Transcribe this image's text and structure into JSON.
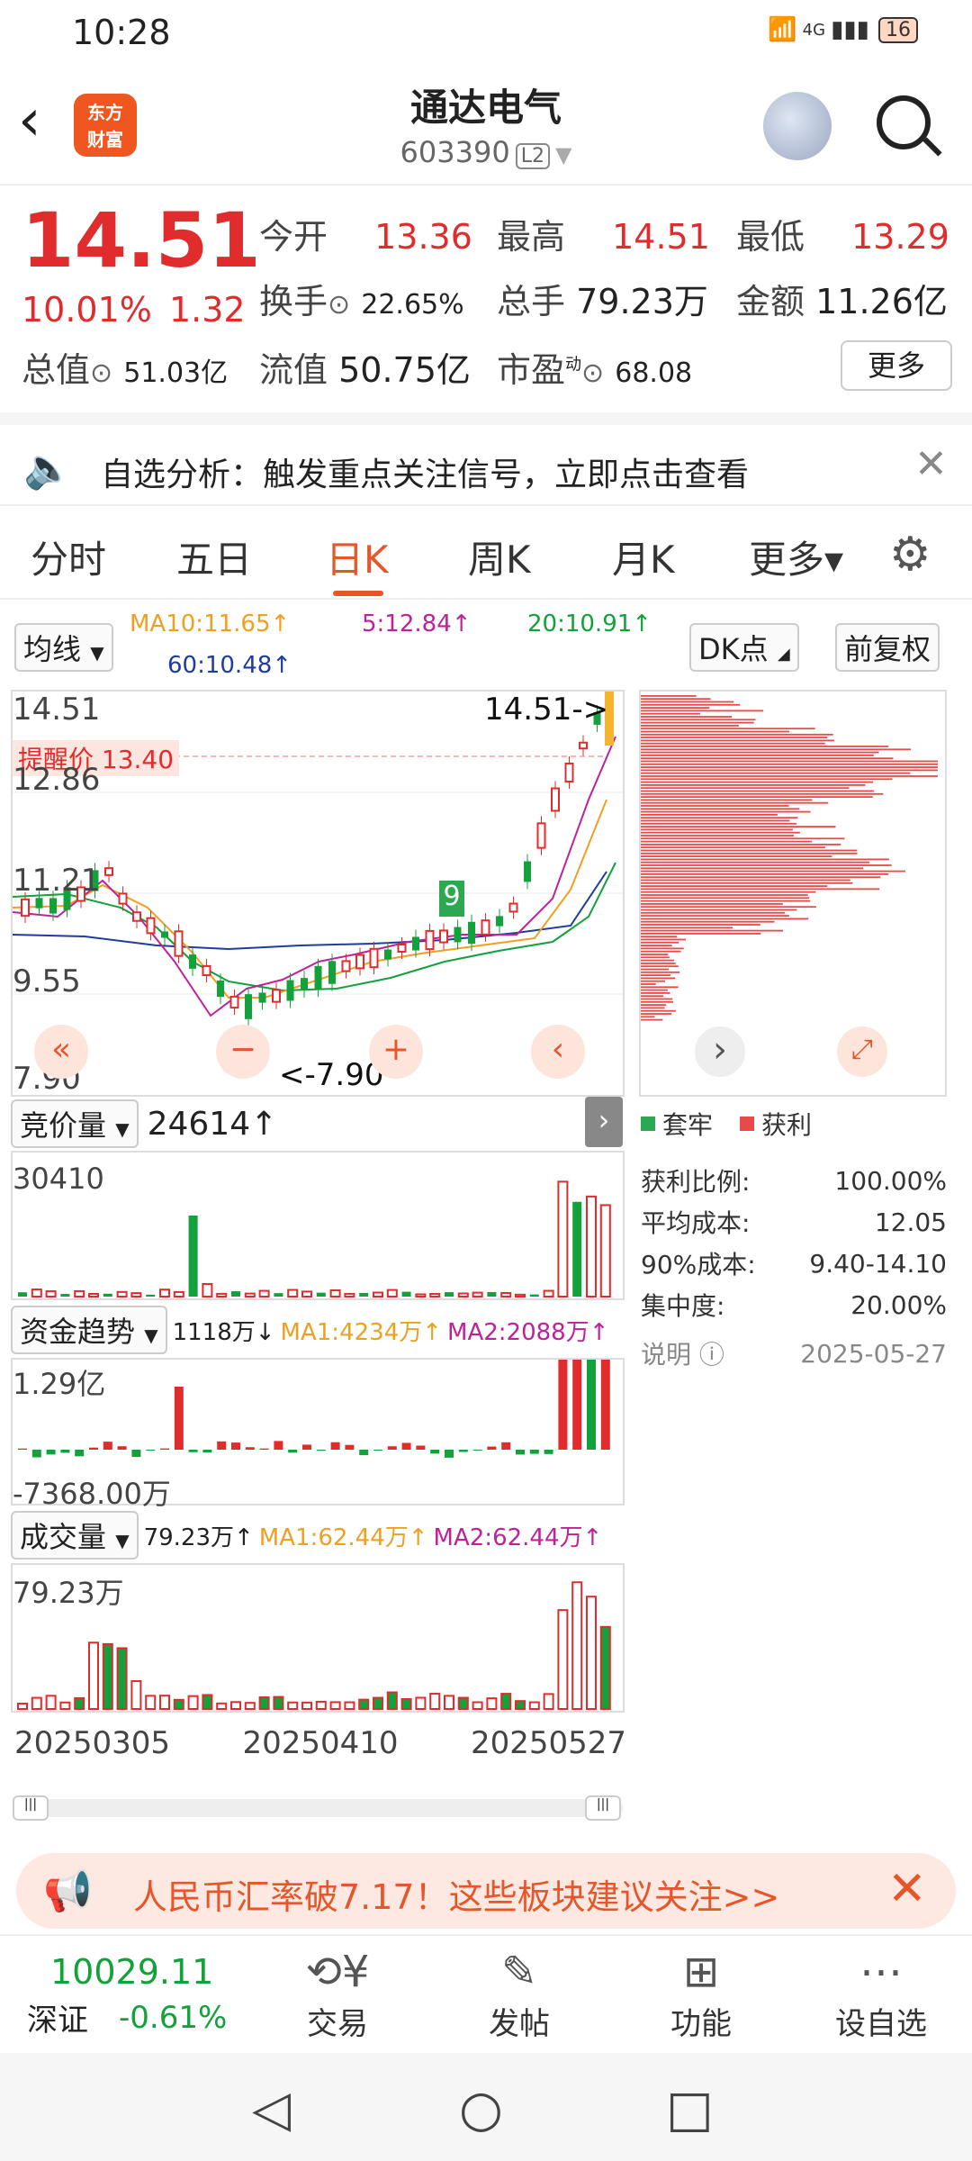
{
  "status": {
    "time": "10:28",
    "battery": "16",
    "network": "4G"
  },
  "header": {
    "brand_line1": "东方",
    "brand_line2": "财富",
    "stock_name": "通达电气",
    "stock_code": "603390",
    "level": "L2"
  },
  "quote": {
    "price": "14.51",
    "pct": "10.01%",
    "change": "1.32",
    "open_label": "今开",
    "open": "13.36",
    "high_label": "最高",
    "high": "14.51",
    "low_label": "最低",
    "low": "13.29",
    "turnover_label": "换手",
    "turnover": "22.65%",
    "volume_label": "总手",
    "volume": "79.23万",
    "amount_label": "金额",
    "amount": "11.26亿",
    "mktcap_label": "总值",
    "mktcap": "51.03亿",
    "float_label": "流值",
    "float": "50.75亿",
    "pe_label": "市盈",
    "pe_sup": "动",
    "pe": "68.08",
    "more": "更多"
  },
  "alert": {
    "text": "自选分析：触发重点关注信号，立即点击查看"
  },
  "tabs": [
    "分时",
    "五日",
    "日K",
    "周K",
    "月K",
    "更多▾"
  ],
  "active_tab": "日K",
  "indicators": {
    "ma_label": "均线",
    "ma10": "MA10:11.65↑",
    "ma5": "5:12.84↑",
    "ma20": "20:10.91↑",
    "ma60": "60:10.48↑",
    "dk": "DK点",
    "adjust": "前复权",
    "colors": {
      "ma10": "#f0a020",
      "ma5": "#c0209a",
      "ma20": "#13a13b",
      "ma60": "#1f3c9e"
    }
  },
  "kchart": {
    "y_top": "14.51",
    "y_2": "12.86",
    "y_3": "11.21",
    "y_4": "9.55",
    "y_bottom": "7.90",
    "last_price_tag": "14.51->",
    "reminder": "提醒价 13.40",
    "low_marker": "<-7.90",
    "nine_marker": "9"
  },
  "auction": {
    "label": "竞价量",
    "value": "24614↑",
    "axis_top": "30410"
  },
  "fund": {
    "label": "资金趋势",
    "value": "1118万↓",
    "ma1": "MA1:4234万↑",
    "ma2": "MA2:2088万↑",
    "axis_top": "1.29亿",
    "axis_bottom": "-7368.00万"
  },
  "volume": {
    "label": "成交量",
    "value": "79.23万↑",
    "ma1": "MA1:62.44万↑",
    "ma2": "MA2:62.44万↑",
    "axis_top": "79.23万",
    "dates": [
      "20250305",
      "20250410",
      "20250527"
    ]
  },
  "chips": {
    "legend_trapped": "套牢",
    "legend_profit": "获利",
    "profit_ratio_label": "获利比例:",
    "profit_ratio": "100.00%",
    "avg_cost_label": "平均成本:",
    "avg_cost": "12.05",
    "cost90_label": "90%成本:",
    "cost90": "9.40-14.10",
    "concentration_label": "集中度:",
    "concentration": "20.00%",
    "note_label": "说明",
    "date": "2025-05-27"
  },
  "promo": {
    "text": "人民币汇率破7.17！这些板块建议关注>>"
  },
  "toolbar": {
    "index_value": "10029.11",
    "index_name": "深证",
    "index_change": "-0.61%",
    "trade": "交易",
    "post": "发帖",
    "functions": "功能",
    "watch": "设自选"
  }
}
